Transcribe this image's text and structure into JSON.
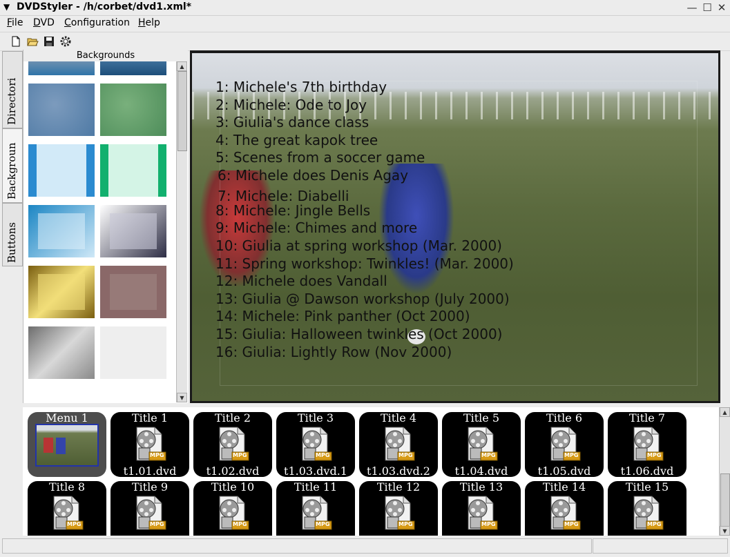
{
  "window": {
    "title": "DVDStyler - /h/corbet/dvd1.xml*"
  },
  "menubar": [
    {
      "first": "F",
      "rest": "ile"
    },
    {
      "first": "D",
      "rest": "VD"
    },
    {
      "first": "C",
      "rest": "onfiguration"
    },
    {
      "first": "H",
      "rest": "elp"
    }
  ],
  "toolbar": {
    "icons": [
      "new-icon",
      "open-icon",
      "save-icon",
      "settings-icon"
    ]
  },
  "vtabs": [
    "Directori",
    "Backgroun",
    "Buttons"
  ],
  "backgrounds": {
    "header": "Backgrounds",
    "colors": {
      "blue": "#2b8bd0",
      "green": "#12b06e"
    }
  },
  "menu_preview": {
    "items": [
      "1: Michele's 7th birthday",
      "2: Michele: Ode to Joy",
      "3: Giulia's dance class",
      "4: The great kapok tree",
      "5: Scenes from a soccer game",
      "6: Michele does Denis Agay",
      "7: Michele: Diabelli",
      "8: Michele: Jingle Bells",
      "9: Michele: Chimes and more",
      "10: Giulia at spring workshop (Mar. 2000)",
      "11: Spring workshop: Twinkles! (Mar. 2000)",
      "12: Michele does Vandall",
      "13: Giulia @ Dawson workshop (July 2000)",
      "14: Michele: Pink panther (Oct 2000)",
      "15: Giulia: Halloween twinkles (Oct 2000)",
      "16: Giulia: Lightly Row (Nov 2000)"
    ]
  },
  "titleset": {
    "row1": [
      {
        "name": "Menu 1",
        "file": ""
      },
      {
        "name": "Title 1",
        "file": "t1.01.dvd"
      },
      {
        "name": "Title 2",
        "file": "t1.02.dvd"
      },
      {
        "name": "Title 3",
        "file": "t1.03.dvd.1"
      },
      {
        "name": "Title 4",
        "file": "t1.03.dvd.2"
      },
      {
        "name": "Title 5",
        "file": "t1.04.dvd"
      },
      {
        "name": "Title 6",
        "file": "t1.05.dvd"
      },
      {
        "name": "Title 7",
        "file": "t1.06.dvd"
      }
    ],
    "row2": [
      {
        "name": "Title 8",
        "file": ""
      },
      {
        "name": "Title 9",
        "file": ""
      },
      {
        "name": "Title 10",
        "file": ""
      },
      {
        "name": "Title 11",
        "file": ""
      },
      {
        "name": "Title 12",
        "file": ""
      },
      {
        "name": "Title 13",
        "file": ""
      },
      {
        "name": "Title 14",
        "file": ""
      },
      {
        "name": "Title 15",
        "file": ""
      }
    ],
    "mpg_label": "MPG"
  },
  "statusbar": {
    "left": "",
    "right": ""
  }
}
